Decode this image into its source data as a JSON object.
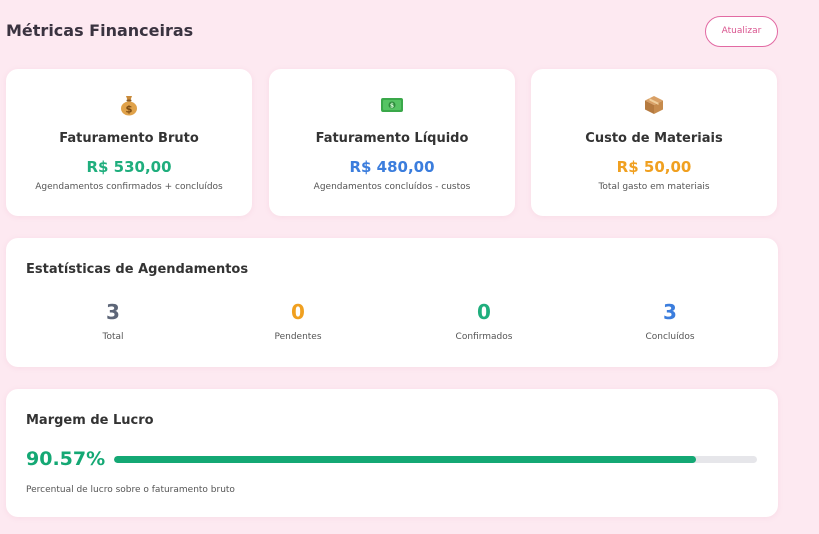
{
  "header": {
    "title": "Métricas Financeiras",
    "refresh_label": "Atualizar"
  },
  "metrics": [
    {
      "icon": "money-bag-icon",
      "title": "Faturamento Bruto",
      "value": "R$ 530,00",
      "color": "#1fae7d",
      "description": "Agendamentos confirmados + concluídos"
    },
    {
      "icon": "banknote-icon",
      "title": "Faturamento Líquido",
      "value": "R$ 480,00",
      "color": "#3b7ddd",
      "description": "Agendamentos concluídos - custos"
    },
    {
      "icon": "package-icon",
      "title": "Custo de Materiais",
      "value": "R$ 50,00",
      "color": "#f0a020",
      "description": "Total gasto em materiais"
    }
  ],
  "stats": {
    "title": "Estatísticas de Agendamentos",
    "items": [
      {
        "value": "3",
        "label": "Total",
        "color": "#5d6678"
      },
      {
        "value": "0",
        "label": "Pendentes",
        "color": "#f0a020"
      },
      {
        "value": "0",
        "label": "Confirmados",
        "color": "#1fae7d"
      },
      {
        "value": "3",
        "label": "Concluídos",
        "color": "#3b7ddd"
      }
    ]
  },
  "margin": {
    "title": "Margem de Lucro",
    "percent_text": "90.57%",
    "percent": 90.57,
    "color": "#14a874",
    "description": "Percentual de lucro sobre o faturamento bruto"
  }
}
